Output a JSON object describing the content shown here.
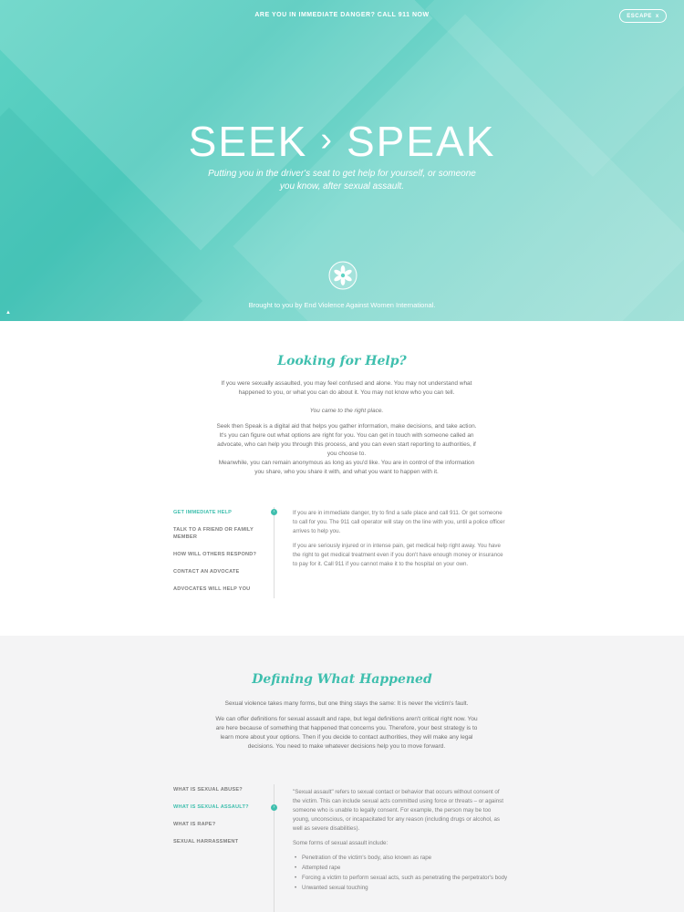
{
  "hero": {
    "danger_text": "ARE YOU IN IMMEDIATE DANGER? CALL 911 NOW",
    "escape_label": "ESCAPE",
    "escape_icon": "x",
    "brand_left": "SEEK",
    "brand_sep": "›",
    "brand_right": "SPEAK",
    "tagline": "Putting you in the driver's seat to get help for yourself, or someone you know, after sexual assault.",
    "brought_by": "Brought to you by End Violence Against Women International."
  },
  "section1": {
    "title": "Looking for Help?",
    "paragraphs": [
      "If you were sexually assaulted, you may feel confused and alone. You may not understand what happened to you, or what you can do about it. You may not know who you can tell.",
      "You came to the right place.",
      "Seek then Speak is a digital aid that helps you gather information, make decisions, and take action. It's you can figure out what options are right for you. You can get in touch with someone called an advocate, who can help you through this process, and you can even start reporting to authorities, if you choose to.",
      "Meanwhile, you can remain anonymous as long as you'd like. You are in control of the information you share, who you share it with, and what you want to happen with it."
    ],
    "nav": [
      "GET IMMEDIATE HELP",
      "TALK TO A FRIEND OR FAMILY MEMBER",
      "HOW WILL OTHERS RESPOND?",
      "CONTACT AN ADVOCATE",
      "ADVOCATES WILL HELP YOU"
    ],
    "content": [
      "If you are in immediate danger, try to find a safe place and call 911. Or get someone to call for you. The 911 call operator will stay on the line with you, until a police officer arrives to help you.",
      "If you are seriously injured or in intense pain, get medical help right away. You have the right to get medical treatment even if you don't have enough money or insurance to pay for it. Call 911 if you cannot make it to the hospital on your own."
    ]
  },
  "section2": {
    "title": "Defining What Happened",
    "paragraphs": [
      "Sexual violence takes many forms, but one thing stays the same: It is never the victim's fault.",
      "We can offer definitions for sexual assault and rape, but legal definitions aren't critical right now. You are here because of something that happened that concerns you. Therefore, your best strategy is to learn more about your options. Then if you decide to contact authorities, they will make any legal decisions. You need to make whatever decisions help you to move forward."
    ],
    "nav": [
      "WHAT IS SEXUAL ABUSE?",
      "WHAT IS SEXUAL ASSAULT?",
      "WHAT IS RAPE?",
      "SEXUAL HARRASSMENT"
    ],
    "content_intro": "\"Sexual assault\" refers to sexual contact or behavior that occurs without consent of the victim. This can include sexual acts committed using force or threats – or against someone who is unable to legally consent. For example, the person may be too young, unconscious, or incapacitated for any reason (including drugs or alcohol, as well as severe disabilities).",
    "content_lead": "Some forms of sexual assault include:",
    "bullets": [
      "Penetration of the victim's body, also known as rape",
      "Attempted rape",
      "Forcing a victim to perform sexual acts, such as penetrating the perpetrator's body",
      "Unwanted sexual touching"
    ]
  },
  "colors": {
    "accent": "#3fbfae",
    "hero_teal": "#5fd3c4"
  }
}
